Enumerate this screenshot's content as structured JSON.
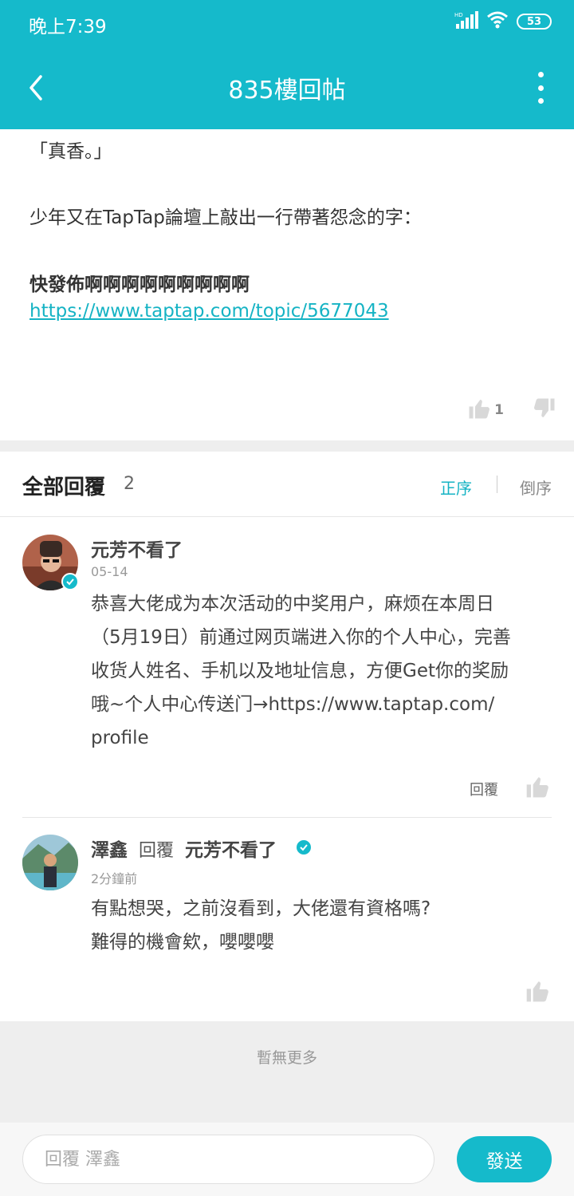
{
  "status_bar": {
    "time": "晚上7:39",
    "battery": "53",
    "network": "HD"
  },
  "header": {
    "title": "835樓回帖"
  },
  "post": {
    "line1": "「真香。」",
    "line2": "少年又在TapTap論壇上敲出一行帶著怨念的字：",
    "bold_line": "快發佈啊啊啊啊啊啊啊啊啊",
    "link": "https://www.taptap.com/topic/5677043",
    "likes": "1"
  },
  "replies_header": {
    "title": "全部回覆",
    "count": "2",
    "sort_asc": "正序",
    "sort_desc": "倒序"
  },
  "replies": [
    {
      "author": "元芳不看了",
      "date": "05-14",
      "lines": [
        "恭喜大佬成为本次活动的中奖用户，麻烦在本周日",
        "（5月19日）前通过网页端进入你的个人中心，完善",
        "收货人姓名、手机以及地址信息，方便Get你的奖励",
        "哦~个人中心传送门→https://www.taptap.com/",
        "profile"
      ],
      "reply_label": "回覆"
    },
    {
      "author": "澤鑫",
      "reply_word": "回覆",
      "reply_to": "元芳不看了",
      "date": "2分鐘前",
      "lines": [
        "有點想哭，之前沒看到，大佬還有資格嗎?",
        "難得的機會欸，嚶嚶嚶"
      ]
    }
  ],
  "footer": {
    "no_more": "暫無更多"
  },
  "input_bar": {
    "placeholder": "回覆 澤鑫",
    "send": "發送"
  },
  "colors": {
    "accent": "#15bacb",
    "link": "#15b3c4"
  }
}
